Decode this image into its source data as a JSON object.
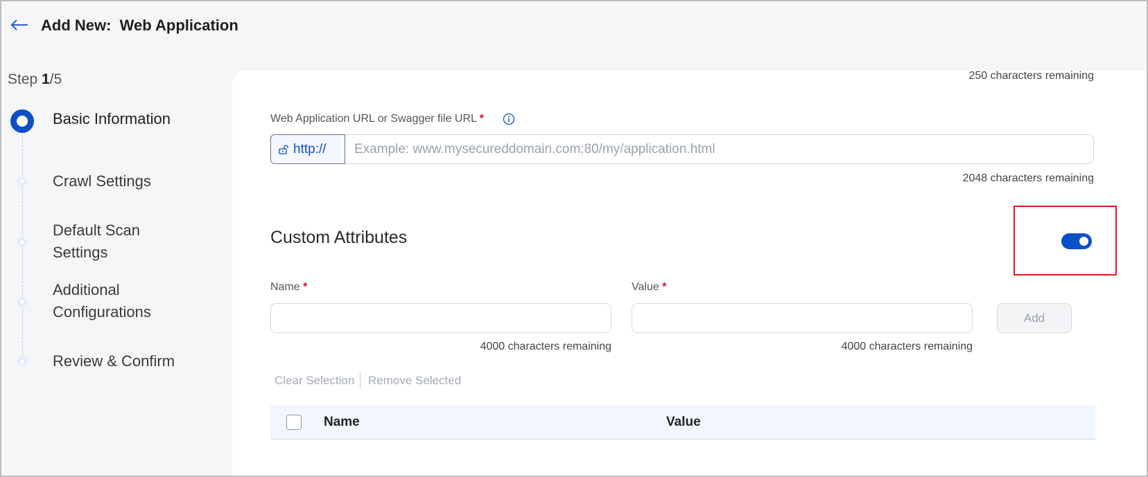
{
  "header": {
    "title": "Add New:  Web Application",
    "back_icon": "arrow-left-icon"
  },
  "stepper": {
    "step_prefix": "Step ",
    "current": "1",
    "total_suffix": "/5",
    "steps": [
      {
        "label": "Basic Information",
        "state": "active"
      },
      {
        "label": "Crawl Settings",
        "state": "pending"
      },
      {
        "label": "Default Scan Settings",
        "state": "pending"
      },
      {
        "label": "Additional Configurations",
        "state": "pending"
      },
      {
        "label": "Review & Confirm",
        "state": "pending"
      }
    ]
  },
  "form": {
    "top_chars_remaining": "250 characters remaining",
    "url": {
      "label": "Web Application URL or Swagger file URL",
      "required_mark": "*",
      "info_icon": "info-circle-icon",
      "prefix": "http://",
      "prefix_icon": "unlock-icon",
      "placeholder": "Example: www.mysecureddomain.com:80/my/application.html",
      "value": "",
      "chars_remaining": "2048 characters remaining"
    },
    "custom_attributes": {
      "title": "Custom Attributes",
      "toggle_on": true,
      "name_label": "Name",
      "value_label": "Value",
      "required_mark": "*",
      "name_value": "",
      "value_value": "",
      "name_chars_remaining": "4000 characters remaining",
      "value_chars_remaining": "4000 characters remaining",
      "add_label": "Add",
      "clear_selection": "Clear Selection",
      "remove_selected": "Remove Selected",
      "table": {
        "columns": [
          "Name",
          "Value"
        ],
        "rows": []
      }
    }
  },
  "colors": {
    "accent": "#0b4fc9",
    "required": "#c8102e",
    "highlight": "#e01a1a"
  }
}
